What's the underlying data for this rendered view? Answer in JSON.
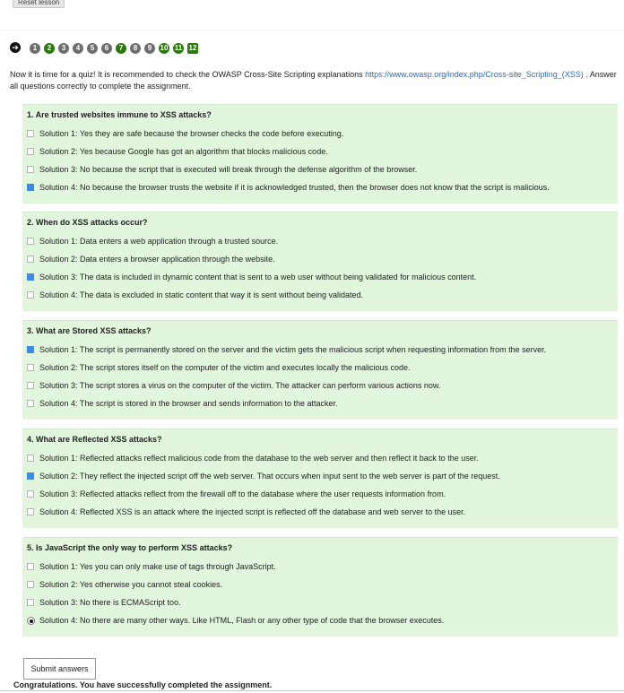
{
  "lesson": {
    "reset_label": "Reset lesson"
  },
  "nav": {
    "pages": [
      {
        "label": "1",
        "state": "gray"
      },
      {
        "label": "2",
        "state": "green"
      },
      {
        "label": "3",
        "state": "gray"
      },
      {
        "label": "4",
        "state": "gray"
      },
      {
        "label": "5",
        "state": "gray"
      },
      {
        "label": "6",
        "state": "gray"
      },
      {
        "label": "7",
        "state": "green"
      },
      {
        "label": "8",
        "state": "gray"
      },
      {
        "label": "9",
        "state": "gray"
      },
      {
        "label": "10",
        "state": "green"
      },
      {
        "label": "11",
        "state": "green"
      },
      {
        "label": "12",
        "state": "current"
      }
    ]
  },
  "intro": {
    "text_before": "Now it is time for a quiz! It is recommended to check the OWASP Cross-Site Scripting explanations ",
    "link": "https://www.owasp.org/index.php/Cross-site_Scripting_(XSS)",
    "text_after": " . Answer all questions correctly to complete the assignment."
  },
  "questions": [
    {
      "title": "1. Are trusted websites immune to XSS attacks?",
      "input_type": "checkbox",
      "options": [
        {
          "label": "Solution 1: Yes they are safe because the browser checks the code before executing.",
          "selected": false
        },
        {
          "label": "Solution 2: Yes because Google has got an algorithm that blocks malicious code.",
          "selected": false
        },
        {
          "label": "Solution 3: No because the script that is executed will break through the defense algorithm of the browser.",
          "selected": false
        },
        {
          "label": "Solution 4: No because the browser trusts the website if it is acknowledged trusted, then the browser does not know that the script is malicious.",
          "selected": true
        }
      ]
    },
    {
      "title": "2. When do XSS attacks occur?",
      "input_type": "checkbox",
      "options": [
        {
          "label": "Solution 1: Data enters a web application through a trusted source.",
          "selected": false
        },
        {
          "label": "Solution 2: Data enters a browser application through the website.",
          "selected": false
        },
        {
          "label": "Solution 3: The data is included in dynamic content that is sent to a web user without being validated for malicious content.",
          "selected": true
        },
        {
          "label": "Solution 4: The data is excluded in static content that way it is sent without being validated.",
          "selected": false
        }
      ]
    },
    {
      "title": "3. What are Stored XSS attacks?",
      "input_type": "checkbox",
      "options": [
        {
          "label": "Solution 1: The script is permanently stored on the server and the victim gets the malicious script when requesting information from the server.",
          "selected": true
        },
        {
          "label": "Solution 2: The script stores itself on the computer of the victim and executes locally the malicious code.",
          "selected": false
        },
        {
          "label": "Solution 3: The script stores a virus on the computer of the victim. The attacker can perform various actions now.",
          "selected": false
        },
        {
          "label": "Solution 4: The script is stored in the browser and sends information to the attacker.",
          "selected": false
        }
      ]
    },
    {
      "title": "4. What are Reflected XSS attacks?",
      "input_type": "checkbox",
      "options": [
        {
          "label": "Solution 1: Reflected attacks reflect malicious code from the database to the web server and then reflect it back to the user.",
          "selected": false
        },
        {
          "label": "Solution 2: They reflect the injected script off the web server. That occurs when input sent to the web server is part of the request.",
          "selected": true
        },
        {
          "label": "Solution 3: Reflected attacks reflect from the firewall off to the database where the user requests information from.",
          "selected": false
        },
        {
          "label": "Solution 4: Reflected XSS is an attack where the injected script is reflected off the database and web server to the user.",
          "selected": false
        }
      ]
    },
    {
      "title": "5. Is JavaScript the only way to perform XSS attacks?",
      "input_type": "mixed",
      "options": [
        {
          "label": "Solution 1: Yes you can only make use of tags through JavaScript.",
          "selected": false
        },
        {
          "label": "Solution 2: Yes otherwise you cannot steal cookies.",
          "selected": false
        },
        {
          "label": "Solution 3: No there is ECMAScript too.",
          "selected": false
        },
        {
          "label": "Solution 4: No there are many other ways. Like HTML, Flash or any other type of code that the browser executes.",
          "selected": true,
          "control": "radio"
        }
      ]
    }
  ],
  "submit_label": "Submit answers",
  "result_message": "Congratulations. You have successfully completed the assignment.",
  "colors": {
    "box_bg": "#e1f6dd",
    "checkbox_checked": "#3a8de2",
    "page_done": "#2b7a0b",
    "page_pending": "#6e6e6e",
    "link": "#2a6db3"
  }
}
